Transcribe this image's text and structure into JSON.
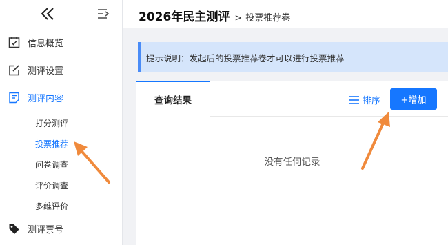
{
  "sidebar": {
    "items": [
      {
        "label": "信息概览",
        "icon": "checklist-icon"
      },
      {
        "label": "测评设置",
        "icon": "edit-icon"
      },
      {
        "label": "测评内容",
        "icon": "document-list-icon"
      },
      {
        "label": "测评票号",
        "icon": "tag-icon"
      }
    ],
    "sub_items": [
      "打分测评",
      "投票推荐",
      "问卷调查",
      "评价调查",
      "多维评价"
    ],
    "active_item": "测评内容",
    "active_sub_item": "投票推荐"
  },
  "header": {
    "title": "2026年民主测评",
    "separator": ">",
    "breadcrumb": "投票推荐卷"
  },
  "notice": {
    "text": "提示说明：发起后的投票推荐卷才可以进行投票推荐"
  },
  "panel": {
    "tab_label": "查询结果",
    "sort_label": "排序",
    "add_label": "+增加",
    "empty_text": "没有任何记录"
  },
  "colors": {
    "accent": "#1677ff",
    "notice_bg": "#d5e5fb",
    "annotation_arrow": "#f08a3c"
  }
}
